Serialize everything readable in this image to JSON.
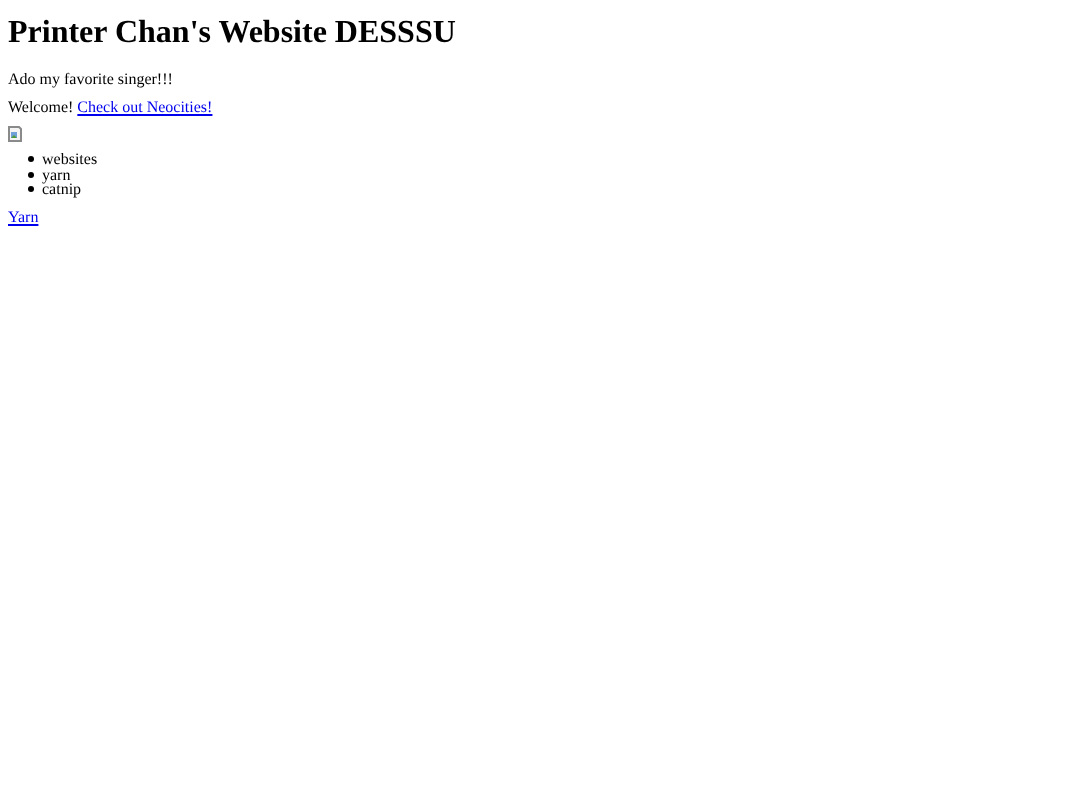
{
  "heading": "Printer Chan's Website DESSSU",
  "tagline": "Ado my favorite singer!!!",
  "welcome": {
    "text": "Welcome!",
    "link": "Check out Neocities!"
  },
  "image": {
    "kind": "broken-image"
  },
  "list": [
    "websites",
    "yarn",
    "catnip"
  ],
  "footer_link": "Yarn"
}
